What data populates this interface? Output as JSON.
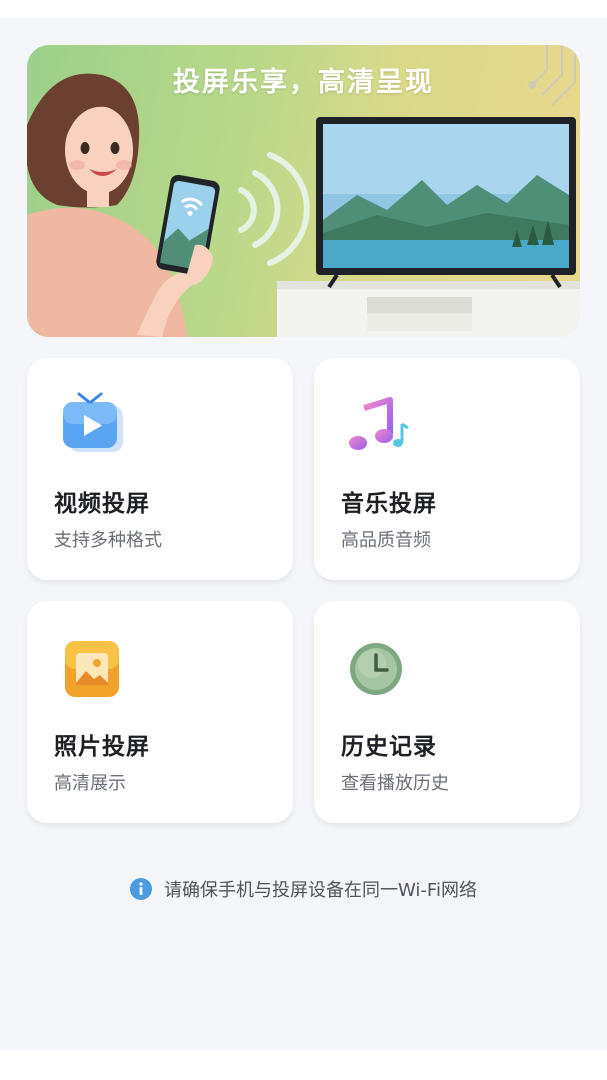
{
  "banner": {
    "title": "投屏乐享，高清呈现"
  },
  "cards": [
    {
      "title": "视频投屏",
      "subtitle": "支持多种格式",
      "icon": "tv-play-icon"
    },
    {
      "title": "音乐投屏",
      "subtitle": "高品质音频",
      "icon": "music-note-icon"
    },
    {
      "title": "照片投屏",
      "subtitle": "高清展示",
      "icon": "photo-icon"
    },
    {
      "title": "历史记录",
      "subtitle": "查看播放历史",
      "icon": "clock-icon"
    }
  ],
  "notice": {
    "text": "请确保手机与投屏设备在同一Wi-Fi网络",
    "icon": "info-icon"
  },
  "colors": {
    "background": "#f4f6fa",
    "card": "#ffffff",
    "info_blue": "#4a9be0"
  }
}
